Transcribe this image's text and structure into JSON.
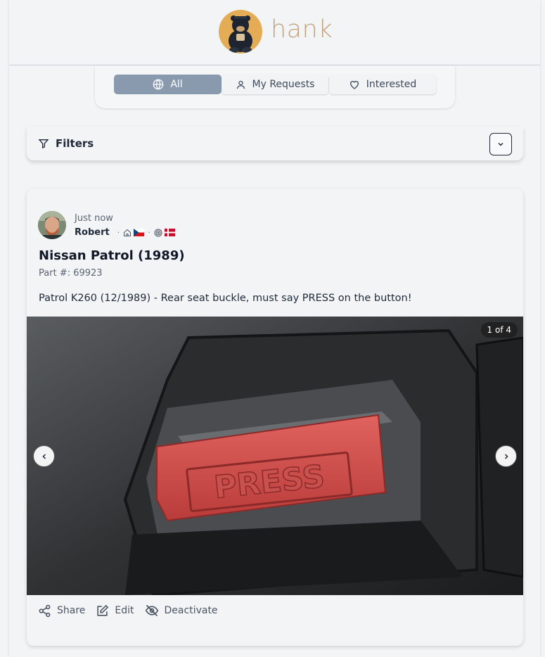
{
  "brand": {
    "name": "hank",
    "logo_icon": "bear-logo-icon",
    "accent": "#c2a37d"
  },
  "tabs": [
    {
      "label": "All",
      "icon": "globe-icon",
      "active": true
    },
    {
      "label": "My Requests",
      "icon": "user-icon",
      "active": false
    },
    {
      "label": "Interested",
      "icon": "heart-icon",
      "active": false
    }
  ],
  "filters": {
    "label": "Filters",
    "icon": "filter-icon",
    "toggle_icon": "chevron-down-icon"
  },
  "post": {
    "time": "Just now",
    "author": "Robert",
    "location_flags": [
      "cz",
      "dk"
    ],
    "title": "Nissan Patrol (1989)",
    "part_number": "Part #: 69923",
    "description": "Patrol K260 (12/1989) - Rear seat buckle, must say PRESS on the button!",
    "image_counter": "1 of 4",
    "actions": {
      "share": "Share",
      "edit": "Edit",
      "deactivate": "Deactivate"
    }
  }
}
